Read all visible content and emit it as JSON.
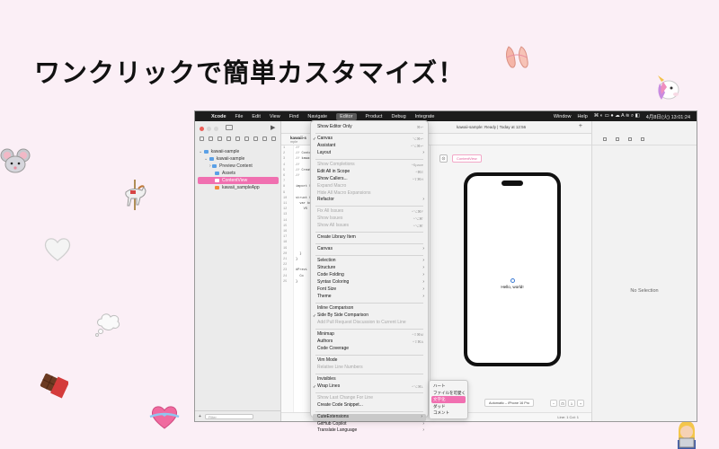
{
  "headline": "ワンクリックで簡単カスタマイズ！",
  "decorations": [
    "ballet-shoes-icon",
    "unicorn-icon",
    "mouse-icon",
    "carousel-horse-icon",
    "white-heart-icon",
    "thought-balloon-icon",
    "chocolate-bar-icon",
    "heart-with-ribbon-icon",
    "person-with-laptop-icon"
  ],
  "menubar": {
    "apple": "",
    "app": "Xcode",
    "items": [
      "File",
      "Edit",
      "View",
      "Find",
      "Navigate",
      "Editor",
      "Product",
      "Debug",
      "Integrate"
    ],
    "selected": "Editor",
    "window": "Window",
    "help": "Help",
    "clock": "4月8日(火) 13:01:24"
  },
  "navigator": {
    "tree": [
      {
        "label": "kawaii-sample",
        "indent": 0,
        "selected": false
      },
      {
        "label": "kawaii-sample",
        "indent": 1,
        "selected": false
      },
      {
        "label": "Preview Content",
        "indent": 2,
        "selected": false
      },
      {
        "label": "Assets",
        "indent": 2,
        "selected": false
      },
      {
        "label": "ContentView",
        "indent": 2,
        "selected": true
      },
      {
        "label": "kawaii_sampleApp",
        "indent": 2,
        "selected": false
      }
    ],
    "filter_placeholder": "Filter"
  },
  "editor": {
    "status": "kawaii-sample: Ready | Today at 12:56",
    "tab_title": "kawaii-s",
    "tab_sub": "mple",
    "line_numbers": [
      "1",
      "2",
      "3",
      "4",
      "5",
      "6",
      "7",
      "8",
      "9",
      "10",
      "11",
      "12",
      "13",
      "14",
      "15",
      "16",
      "17",
      "18",
      "19",
      "20",
      "21",
      "22",
      "23",
      "24",
      "25"
    ],
    "code_lines": [
      "//",
      "// Content",
      "// kawaii-s",
      "//",
      "// Created",
      "//",
      "",
      "import Sw",
      "",
      "struct Con",
      "  var bo",
      "    VS",
      "",
      "",
      "",
      "",
      "",
      "",
      "",
      "  }",
      "}",
      "",
      "#Previ",
      "  Co",
      "}"
    ],
    "footer": "Line: 1  Col: 1"
  },
  "canvas": {
    "chip": "ContentView",
    "hello": "Hello, world!",
    "device": "Automatic – iPhone 16 Pro"
  },
  "inspector": {
    "no_selection": "No Selection"
  },
  "menu": {
    "items": [
      {
        "type": "item",
        "label": "Show Editor Only",
        "shortcut": "⌘↩",
        "disabled": false,
        "check": false,
        "sub": false
      },
      {
        "type": "sep"
      },
      {
        "type": "item",
        "label": "Canvas",
        "shortcut": "⌥⌘↩",
        "disabled": false,
        "check": true,
        "sub": false
      },
      {
        "type": "item",
        "label": "Assistant",
        "shortcut": "^⌥⌘↩",
        "disabled": false,
        "check": false,
        "sub": false
      },
      {
        "type": "item",
        "label": "Layout",
        "shortcut": "",
        "disabled": false,
        "check": false,
        "sub": true
      },
      {
        "type": "sep"
      },
      {
        "type": "item",
        "label": "Show Completions",
        "shortcut": "^Space",
        "disabled": true,
        "check": false,
        "sub": false
      },
      {
        "type": "item",
        "label": "Edit All in Scope",
        "shortcut": "^⌘E",
        "disabled": false,
        "check": false,
        "sub": false
      },
      {
        "type": "item",
        "label": "Show Callers...",
        "shortcut": "^⇧⌘H",
        "disabled": false,
        "check": false,
        "sub": false
      },
      {
        "type": "item",
        "label": "Expand Macro",
        "shortcut": "",
        "disabled": true,
        "check": false,
        "sub": false
      },
      {
        "type": "item",
        "label": "Hide All Macro Expansions",
        "shortcut": "",
        "disabled": true,
        "check": false,
        "sub": false
      },
      {
        "type": "item",
        "label": "Refactor",
        "shortcut": "",
        "disabled": false,
        "check": false,
        "sub": true
      },
      {
        "type": "sep"
      },
      {
        "type": "item",
        "label": "Fix All Issues",
        "shortcut": "^⌥⌘F",
        "disabled": true,
        "check": false,
        "sub": false
      },
      {
        "type": "item",
        "label": "Show Issues",
        "shortcut": "^⌥⌘'",
        "disabled": true,
        "check": false,
        "sub": false
      },
      {
        "type": "item",
        "label": "Show All Issues",
        "shortcut": "^⌥⌘'",
        "disabled": true,
        "check": false,
        "sub": false
      },
      {
        "type": "sep"
      },
      {
        "type": "item",
        "label": "Create Library Item",
        "shortcut": "",
        "disabled": false,
        "check": false,
        "sub": false
      },
      {
        "type": "sep"
      },
      {
        "type": "item",
        "label": "Canvas",
        "shortcut": "",
        "disabled": false,
        "check": false,
        "sub": true
      },
      {
        "type": "sep"
      },
      {
        "type": "item",
        "label": "Selection",
        "shortcut": "",
        "disabled": false,
        "check": false,
        "sub": true
      },
      {
        "type": "item",
        "label": "Structure",
        "shortcut": "",
        "disabled": false,
        "check": false,
        "sub": true
      },
      {
        "type": "item",
        "label": "Code Folding",
        "shortcut": "",
        "disabled": false,
        "check": false,
        "sub": true
      },
      {
        "type": "item",
        "label": "Syntax Coloring",
        "shortcut": "",
        "disabled": false,
        "check": false,
        "sub": true
      },
      {
        "type": "item",
        "label": "Font Size",
        "shortcut": "",
        "disabled": false,
        "check": false,
        "sub": true
      },
      {
        "type": "item",
        "label": "Theme",
        "shortcut": "",
        "disabled": false,
        "check": false,
        "sub": true
      },
      {
        "type": "sep"
      },
      {
        "type": "item",
        "label": "Inline Comparison",
        "shortcut": "",
        "disabled": false,
        "check": false,
        "sub": false
      },
      {
        "type": "item",
        "label": "Side By Side Comparison",
        "shortcut": "",
        "disabled": false,
        "check": true,
        "sub": false
      },
      {
        "type": "item",
        "label": "Add Pull Request Discussion to Current Line",
        "shortcut": "",
        "disabled": true,
        "check": false,
        "sub": false
      },
      {
        "type": "sep"
      },
      {
        "type": "item",
        "label": "Minimap",
        "shortcut": "^⇧⌘M",
        "disabled": false,
        "check": false,
        "sub": false
      },
      {
        "type": "item",
        "label": "Authors",
        "shortcut": "^⇧⌘A",
        "disabled": false,
        "check": false,
        "sub": false
      },
      {
        "type": "item",
        "label": "Code Coverage",
        "shortcut": "",
        "disabled": false,
        "check": false,
        "sub": false
      },
      {
        "type": "sep"
      },
      {
        "type": "item",
        "label": "Vim Mode",
        "shortcut": "",
        "disabled": false,
        "check": false,
        "sub": false
      },
      {
        "type": "item",
        "label": "Relative Line Numbers",
        "shortcut": "",
        "disabled": true,
        "check": false,
        "sub": false
      },
      {
        "type": "sep"
      },
      {
        "type": "item",
        "label": "Invisibles",
        "shortcut": "",
        "disabled": false,
        "check": false,
        "sub": false
      },
      {
        "type": "item",
        "label": "Wrap Lines",
        "shortcut": "^⌥⌘L",
        "disabled": false,
        "check": true,
        "sub": false
      },
      {
        "type": "sep"
      },
      {
        "type": "item",
        "label": "Show Last Change For Line",
        "shortcut": "",
        "disabled": true,
        "check": false,
        "sub": false
      },
      {
        "type": "item",
        "label": "Create Code Snippet...",
        "shortcut": "",
        "disabled": false,
        "check": false,
        "sub": false
      },
      {
        "type": "sep"
      },
      {
        "type": "item",
        "label": "CuteExtensions",
        "shortcut": "",
        "disabled": false,
        "check": false,
        "sub": true,
        "highlight": true
      },
      {
        "type": "item",
        "label": "GitHub Copilot",
        "shortcut": "",
        "disabled": false,
        "check": false,
        "sub": true
      },
      {
        "type": "item",
        "label": "Translate Language",
        "shortcut": "",
        "disabled": false,
        "check": false,
        "sub": true
      }
    ]
  },
  "submenu": {
    "items": [
      {
        "label": "ハート",
        "highlight": false
      },
      {
        "label": "ファイルを可愛く",
        "highlight": false
      },
      {
        "label": "文字化",
        "highlight": true
      },
      {
        "label": "ダッド",
        "highlight": false
      },
      {
        "label": "コメント",
        "highlight": false
      }
    ]
  },
  "colors": {
    "background": "#fbeff6",
    "accent_pink": "#f070b0",
    "menubar": "#1c1c1c"
  }
}
